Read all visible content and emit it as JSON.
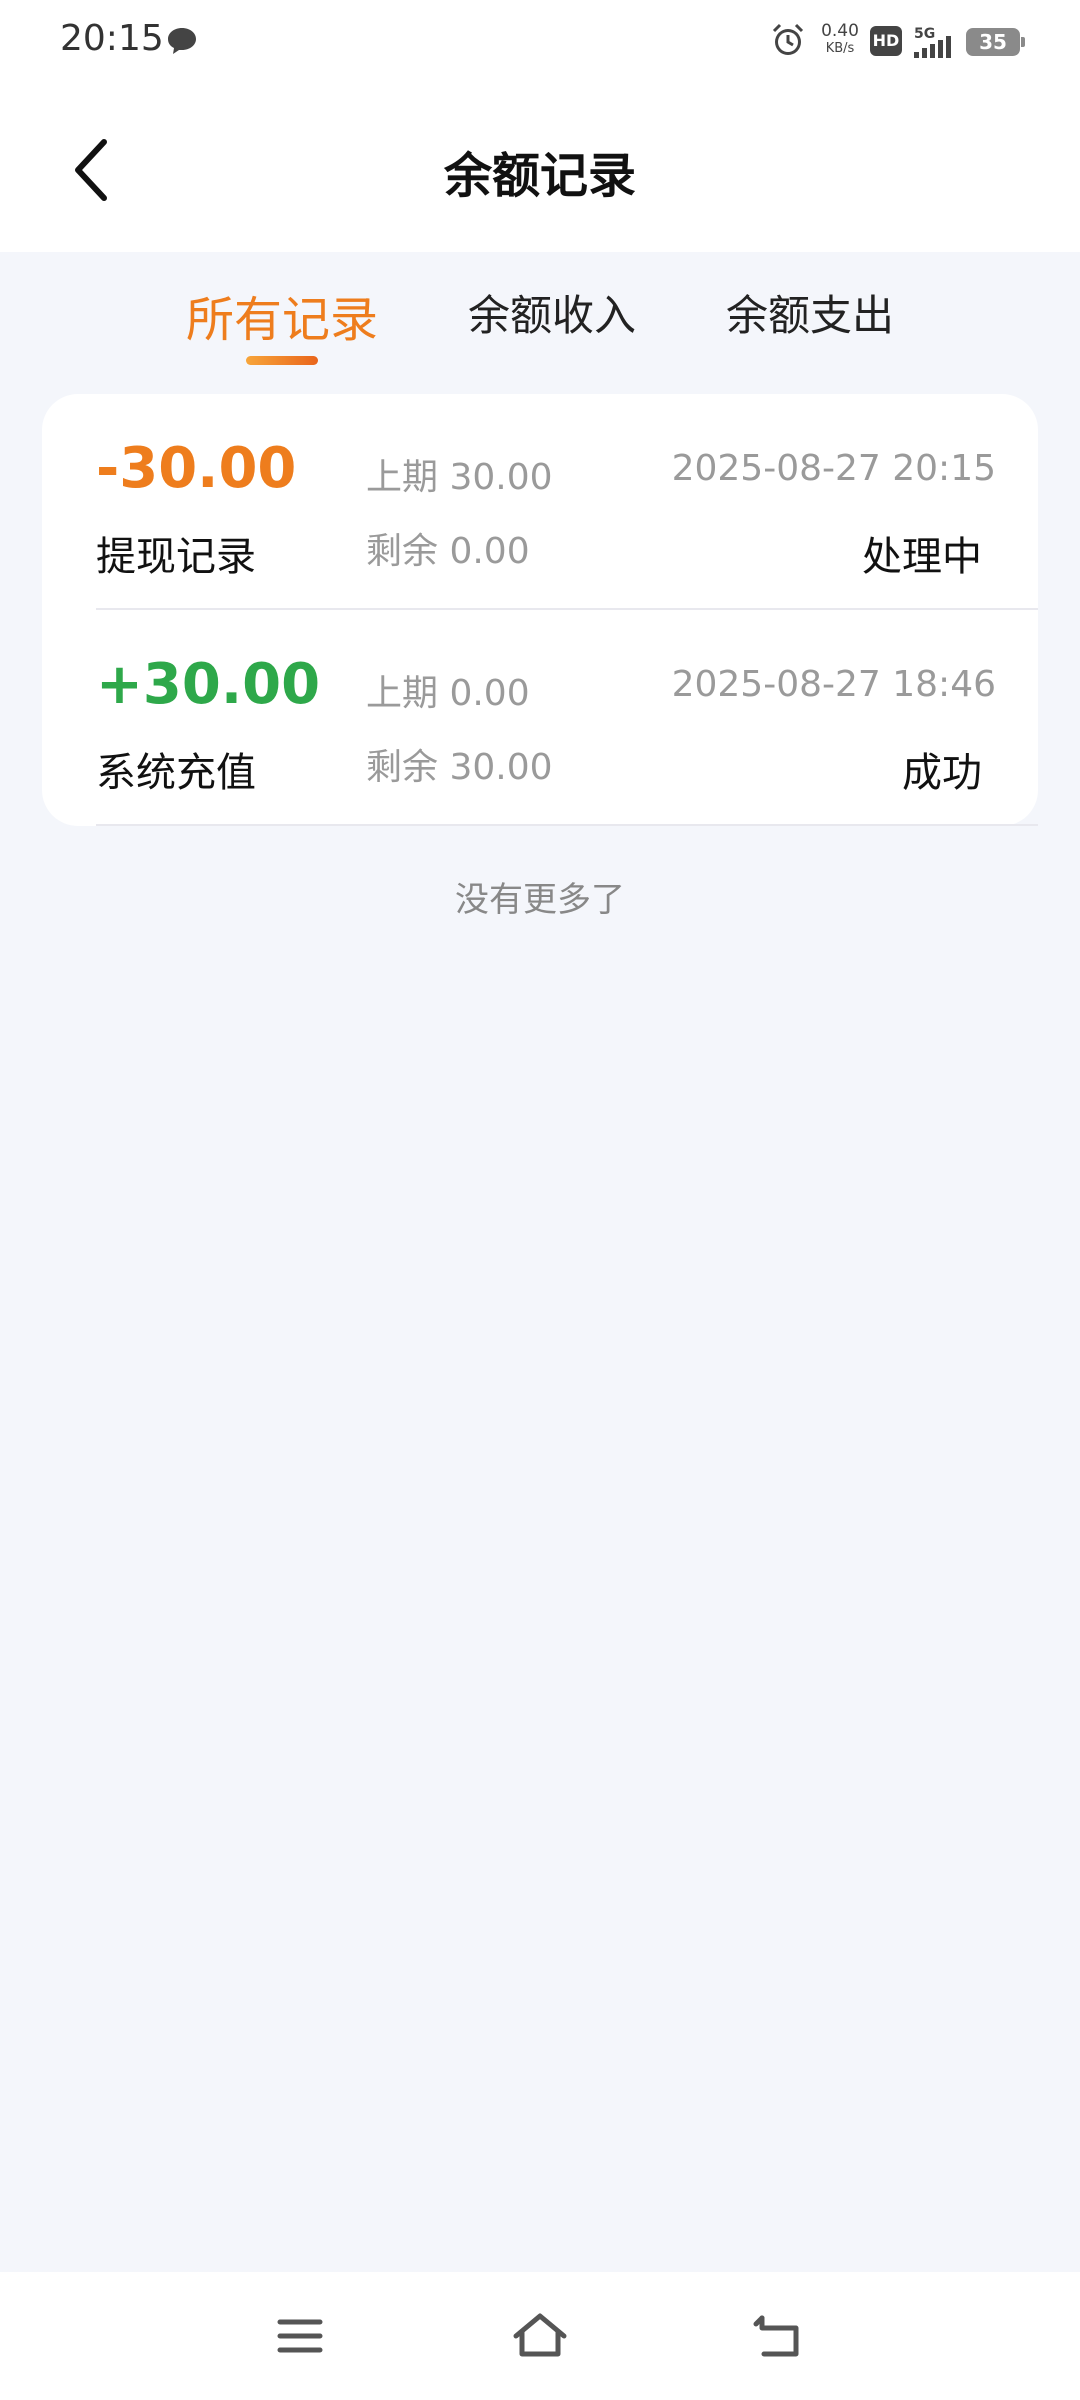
{
  "status_bar": {
    "time": "20:15",
    "net_speed_value": "0.40",
    "net_speed_unit": "KB/s",
    "hd": "HD",
    "network": "5G",
    "battery": "35"
  },
  "header": {
    "title": "余额记录"
  },
  "tabs": [
    {
      "label": "所有记录",
      "active": true
    },
    {
      "label": "余额收入",
      "active": false
    },
    {
      "label": "余额支出",
      "active": false
    }
  ],
  "colors": {
    "accent": "#ee7d1d",
    "positive": "#2ea84a",
    "background": "#f4f6fb"
  },
  "records": [
    {
      "amount": "-30.00",
      "type": "提现记录",
      "previous": "上期 30.00",
      "remaining": "剩余 0.00",
      "datetime": "2025-08-27 20:15",
      "status": "处理中"
    },
    {
      "amount": "+30.00",
      "type": "系统充值",
      "previous": "上期 0.00",
      "remaining": "剩余 30.00",
      "datetime": "2025-08-27 18:46",
      "status": "成功"
    }
  ],
  "footer_text": "没有更多了",
  "system_nav": {
    "icons": [
      "menu-icon",
      "home-icon",
      "back-icon"
    ]
  }
}
